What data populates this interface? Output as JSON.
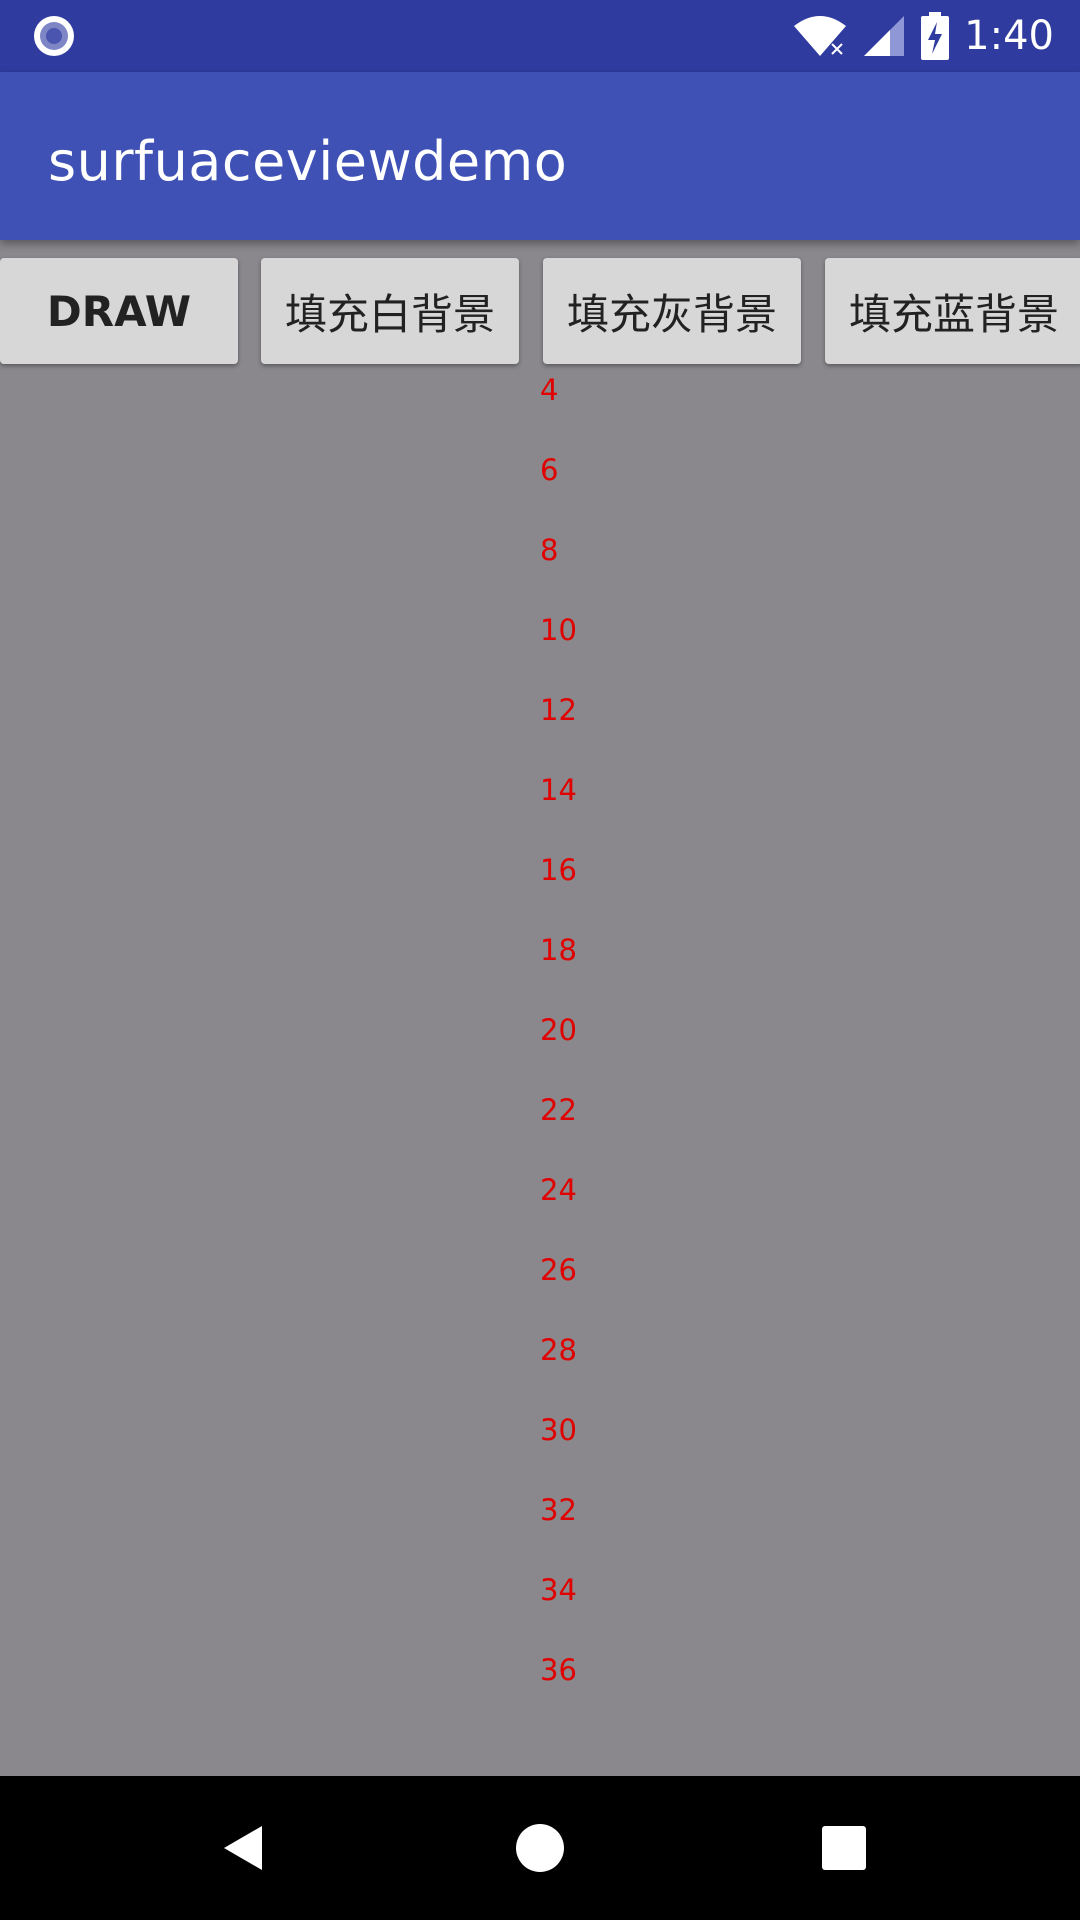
{
  "status_bar": {
    "time": "1:40",
    "icons": [
      "notification-record-icon",
      "wifi-icon",
      "cellular-signal-icon",
      "battery-charging-icon"
    ],
    "background_color": "#2f3b9f"
  },
  "app_bar": {
    "title": "surfuaceviewdemo",
    "background_color": "#3f51b5"
  },
  "buttons": {
    "draw": "DRAW",
    "fill_white": "填充白背景",
    "fill_gray": "填充灰背景",
    "fill_blue": "填充蓝背景"
  },
  "canvas": {
    "background_color": "#8a888c",
    "text_color": "#e00000",
    "numbers": [
      "4",
      "6",
      "8",
      "10",
      "12",
      "14",
      "16",
      "18",
      "20",
      "22",
      "24",
      "26",
      "28",
      "30",
      "32",
      "34",
      "36"
    ]
  },
  "nav_bar": {
    "icons": [
      "back-icon",
      "home-icon",
      "recents-icon"
    ]
  }
}
